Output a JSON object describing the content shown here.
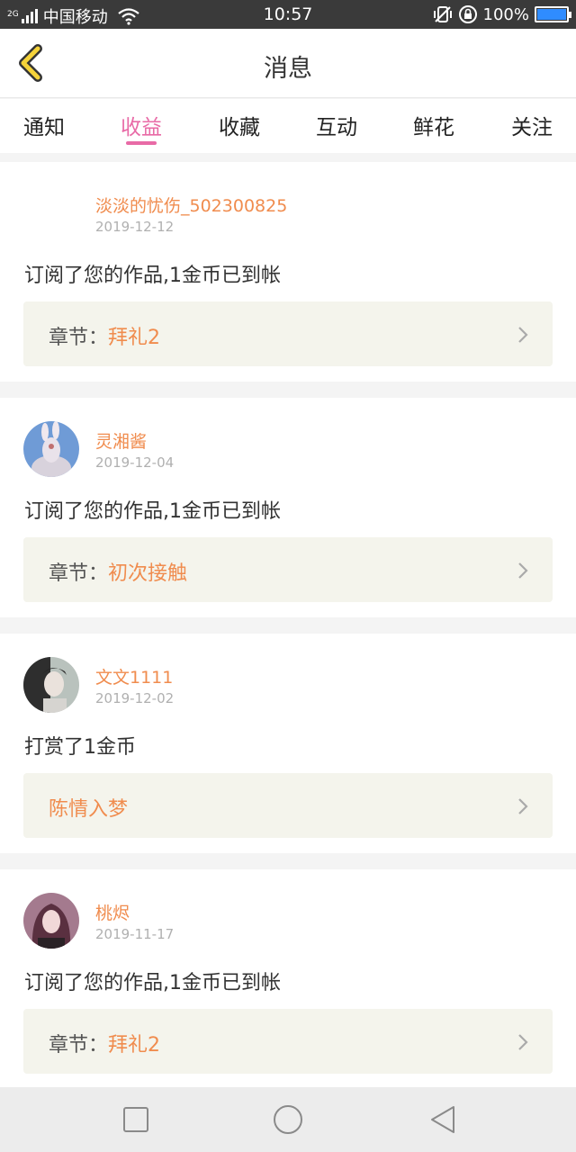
{
  "status_bar": {
    "network_tag": "2G",
    "carrier": "中国移动",
    "time": "10:57",
    "battery": "100%",
    "battery_level": 1.0,
    "icons": [
      "signal-icon",
      "wifi-icon",
      "vibrate-icon",
      "rotation-lock-icon",
      "battery-icon"
    ]
  },
  "header": {
    "title": "消息",
    "back_icon": "chevron-left-icon",
    "accent_color": "#f5d33a"
  },
  "tabs": [
    {
      "label": "通知",
      "active": false
    },
    {
      "label": "收益",
      "active": true
    },
    {
      "label": "收藏",
      "active": false
    },
    {
      "label": "互动",
      "active": false
    },
    {
      "label": "鲜花",
      "active": false
    },
    {
      "label": "关注",
      "active": false
    }
  ],
  "colors": {
    "active_tab": "#e86aa6",
    "name": "#f08c4e",
    "detail_bg": "#f4f4ec"
  },
  "messages": [
    {
      "user": "淡淡的忧伤_502300825",
      "date": "2019-12-12",
      "text": "订阅了您的作品,1金币已到帐",
      "detail_label": "章节：",
      "detail_value": "拜礼2"
    },
    {
      "user": "灵湘酱",
      "date": "2019-12-04",
      "text": "订阅了您的作品,1金币已到帐",
      "detail_label": "章节：",
      "detail_value": "初次接触"
    },
    {
      "user": "文文1111",
      "date": "2019-12-02",
      "text": "打赏了1金币",
      "detail_label": "",
      "detail_value": "陈情入梦"
    },
    {
      "user": "桃烬",
      "date": "2019-11-17",
      "text": "订阅了您的作品,1金币已到帐",
      "detail_label": "章节：",
      "detail_value": "拜礼2"
    }
  ],
  "nav_bar": [
    "square-icon",
    "circle-icon",
    "triangle-back-icon"
  ]
}
